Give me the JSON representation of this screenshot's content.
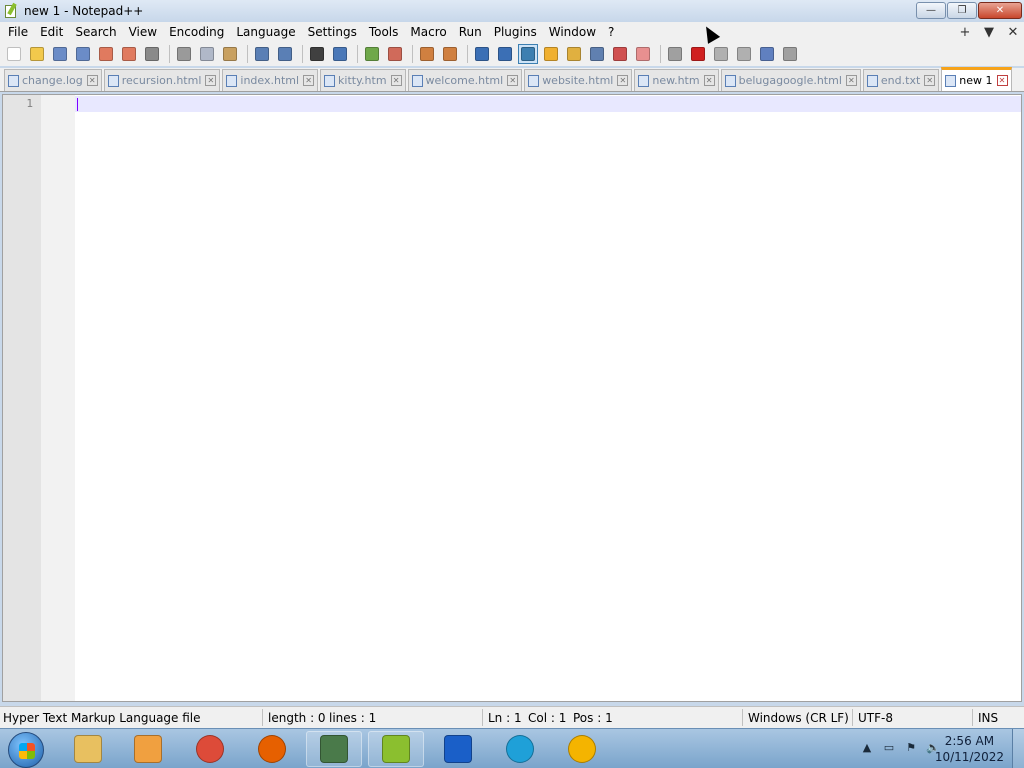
{
  "window": {
    "title": "new 1 - Notepad++",
    "buttons": {
      "minimize": "—",
      "restore": "❐",
      "close": "✕"
    }
  },
  "menu": {
    "items": [
      "File",
      "Edit",
      "Search",
      "View",
      "Encoding",
      "Language",
      "Settings",
      "Tools",
      "Macro",
      "Run",
      "Plugins",
      "Window",
      "?"
    ],
    "right": {
      "add": "+",
      "list": "▼",
      "close": "✕"
    }
  },
  "toolbar": {
    "icons": [
      {
        "name": "new-file-icon",
        "color": "#ffffff"
      },
      {
        "name": "open-file-icon",
        "color": "#f2c94c"
      },
      {
        "name": "save-icon",
        "color": "#6b8cc7"
      },
      {
        "name": "save-all-icon",
        "color": "#6b8cc7"
      },
      {
        "name": "close-icon",
        "color": "#e07a5f"
      },
      {
        "name": "close-all-icon",
        "color": "#e07a5f"
      },
      {
        "name": "print-icon",
        "color": "#8a8a8a"
      },
      {
        "name": "cut-icon",
        "color": "#9a9a9a"
      },
      {
        "name": "copy-icon",
        "color": "#b0b8c8"
      },
      {
        "name": "paste-icon",
        "color": "#c8a060"
      },
      {
        "name": "undo-icon",
        "color": "#5a7fb5"
      },
      {
        "name": "redo-icon",
        "color": "#5a7fb5"
      },
      {
        "name": "find-icon",
        "color": "#404040"
      },
      {
        "name": "replace-icon",
        "color": "#4a78b8"
      },
      {
        "name": "zoom-in-icon",
        "color": "#6fa84a"
      },
      {
        "name": "zoom-out-icon",
        "color": "#d06a5a"
      },
      {
        "name": "sync-vertical-icon",
        "color": "#d08040"
      },
      {
        "name": "sync-horizontal-icon",
        "color": "#d08040"
      },
      {
        "name": "word-wrap-icon",
        "color": "#3b6fb5"
      },
      {
        "name": "show-all-chars-icon",
        "color": "#3b6fb5"
      },
      {
        "name": "indent-guide-icon",
        "color": "#3c7fb1"
      },
      {
        "name": "udl-icon",
        "color": "#f0b030"
      },
      {
        "name": "doc-map-icon",
        "color": "#e0b040"
      },
      {
        "name": "function-list-icon",
        "color": "#6080b0"
      },
      {
        "name": "folder-as-workspace-icon",
        "color": "#d05050"
      },
      {
        "name": "monitoring-icon",
        "color": "#e89090"
      },
      {
        "name": "record-macro-icon",
        "color": "#a0a0a0"
      },
      {
        "name": "stop-record-icon",
        "color": "#d02020"
      },
      {
        "name": "playback-macro-icon",
        "color": "#b0b0b0"
      },
      {
        "name": "run-macro-multiple-icon",
        "color": "#b0b0b0"
      },
      {
        "name": "save-macro-icon",
        "color": "#6080c0"
      },
      {
        "name": "extra-icon",
        "color": "#a0a0a0"
      }
    ]
  },
  "tabs": [
    {
      "label": "change.log",
      "active": false
    },
    {
      "label": "recursion.html",
      "active": false
    },
    {
      "label": "index.html",
      "active": false
    },
    {
      "label": "kitty.htm",
      "active": false
    },
    {
      "label": "welcome.html",
      "active": false
    },
    {
      "label": "website.html",
      "active": false
    },
    {
      "label": "new.htm",
      "active": false
    },
    {
      "label": "belugagoogle.html",
      "active": false
    },
    {
      "label": "end.txt",
      "active": false
    },
    {
      "label": "new 1",
      "active": true
    }
  ],
  "editor": {
    "line_number": "1",
    "content": ""
  },
  "status": {
    "file_type": "Hyper Text Markup Language file",
    "length": "length : 0",
    "lines": "lines : 1",
    "ln": "Ln : 1",
    "col": "Col : 1",
    "pos": "Pos : 1",
    "eol": "Windows (CR LF)",
    "encoding": "UTF-8",
    "mode": "INS"
  },
  "taskbar": {
    "apps": [
      {
        "name": "file-explorer-icon",
        "color": "#e8c060"
      },
      {
        "name": "media-player-icon",
        "color": "#f0a040"
      },
      {
        "name": "chrome-icon",
        "color": "#dd4b39"
      },
      {
        "name": "firefox-icon",
        "color": "#e66000"
      },
      {
        "name": "task-manager-icon",
        "color": "#4a7a4a"
      },
      {
        "name": "notepad-plus-plus-icon",
        "color": "#8bbf2f"
      },
      {
        "name": "malwarebytes-icon",
        "color": "#1a5fc8"
      },
      {
        "name": "edge-icon",
        "color": "#1fa0d8"
      },
      {
        "name": "chrome-canary-icon",
        "color": "#f4b400"
      }
    ],
    "clock": {
      "time": "2:56 AM",
      "date": "10/11/2022"
    },
    "tray": {
      "up_arrow": "▲",
      "network": "▭",
      "flag": "⚑",
      "volume": "🔈"
    }
  }
}
